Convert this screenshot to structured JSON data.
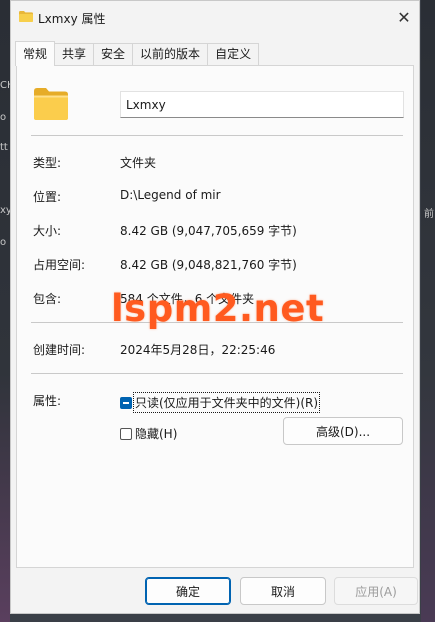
{
  "window": {
    "title": "Lxmxy 属性",
    "close_glyph": "✕"
  },
  "tabs": [
    {
      "label": "常规",
      "active": true
    },
    {
      "label": "共享",
      "active": false
    },
    {
      "label": "安全",
      "active": false
    },
    {
      "label": "以前的版本",
      "active": false
    },
    {
      "label": "自定义",
      "active": false
    }
  ],
  "general": {
    "folder_name": "Lxmxy",
    "rows": {
      "type": {
        "label": "类型:",
        "value": "文件夹"
      },
      "location": {
        "label": "位置:",
        "value": "D:\\Legend of mir"
      },
      "size": {
        "label": "大小:",
        "value": "8.42 GB (9,047,705,659 字节)"
      },
      "size_on_disk": {
        "label": "占用空间:",
        "value": "8.42 GB (9,048,821,760 字节)"
      },
      "contains": {
        "label": "包含:",
        "value": "584 个文件，6 个文件夹"
      },
      "created": {
        "label": "创建时间:",
        "value": "2024年5月28日，22:25:46"
      }
    },
    "attributes": {
      "label": "属性:",
      "readonly_label": "只读(仅应用于文件夹中的文件)(R)",
      "readonly_state": "indeterminate",
      "hidden_label": "隐藏(H)",
      "hidden_checked": false,
      "advanced_label": "高级(D)..."
    }
  },
  "buttons": {
    "ok": "确定",
    "cancel": "取消",
    "apply": "应用(A)"
  },
  "watermark": "lspm2.net",
  "background_glyphs": [
    "CH",
    "o",
    "tt",
    "xy",
    "o",
    "前"
  ],
  "colors": {
    "accent": "#0063b1",
    "watermark": "#ff5a1f"
  },
  "icons": [
    "folder-icon",
    "close-icon"
  ]
}
